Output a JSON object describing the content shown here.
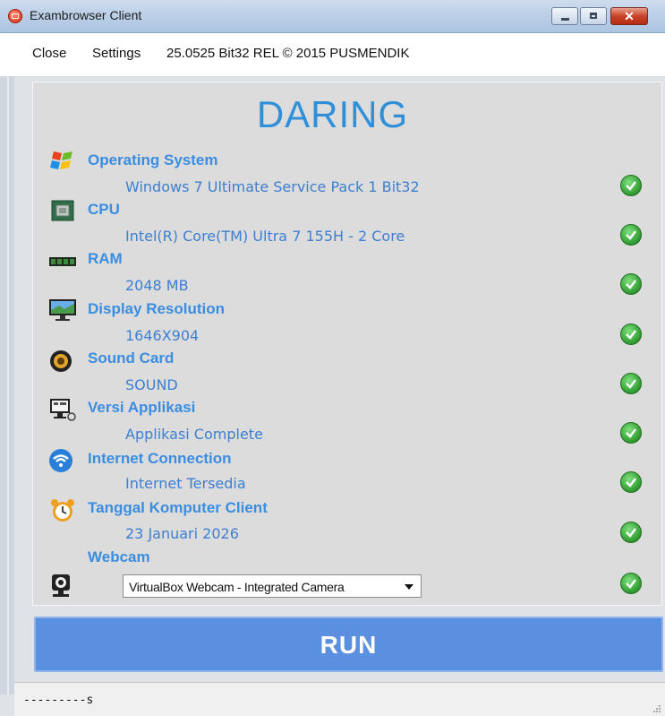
{
  "window": {
    "title": "Exambrowser Client"
  },
  "menu": {
    "close": "Close",
    "settings": "Settings",
    "version": "25.0525 Bit32 REL © 2015 PUSMENDIK"
  },
  "heading": "DARING",
  "items": [
    {
      "label": "Operating System",
      "value": "Windows 7 Ultimate Service Pack 1 Bit32",
      "icon": "windows-logo-icon",
      "status": "ok"
    },
    {
      "label": "CPU",
      "value": "Intel(R) Core(TM) Ultra 7 155H - 2 Core",
      "icon": "cpu-chip-icon",
      "status": "ok"
    },
    {
      "label": "RAM",
      "value": "2048 MB",
      "icon": "ram-module-icon",
      "status": "ok"
    },
    {
      "label": "Display Resolution",
      "value": "1646X904",
      "icon": "monitor-icon",
      "status": "ok"
    },
    {
      "label": "Sound Card",
      "value": "SOUND",
      "icon": "speaker-icon",
      "status": "ok"
    },
    {
      "label": "Versi Applikasi",
      "value": "Applikasi Complete",
      "icon": "computer-app-icon",
      "status": "ok"
    },
    {
      "label": "Internet Connection",
      "value": "Internet Tersedia",
      "icon": "wifi-icon",
      "status": "ok"
    },
    {
      "label": "Tanggal Komputer Client",
      "value": "23 Januari 2026",
      "icon": "alarm-clock-icon",
      "status": "ok"
    }
  ],
  "webcam": {
    "label": "Webcam",
    "selected": "VirtualBox Webcam - Integrated Camera",
    "icon": "webcam-icon",
    "status": "ok"
  },
  "run_label": "RUN",
  "status_text": "---------s",
  "colors": {
    "accent": "#3a8de0",
    "heading": "#2f8fd8",
    "run_button": "#5b8fe0",
    "check": "#2e9a2e"
  }
}
